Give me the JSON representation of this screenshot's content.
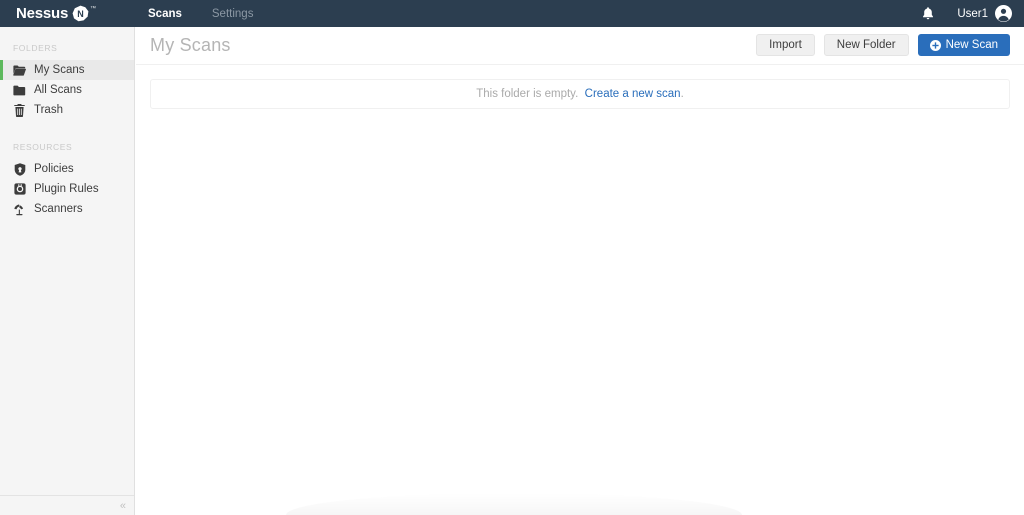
{
  "topnav": {
    "brand": {
      "word": "Nessus",
      "badge_letter": "N",
      "tm": "™",
      "icon": "nessus-logo-icon"
    },
    "links": [
      {
        "label": "Scans",
        "active": true
      },
      {
        "label": "Settings",
        "active": false
      }
    ],
    "notifications_icon": "bell-icon",
    "user_name": "User1",
    "avatar_icon": "user-avatar-icon"
  },
  "sidebar": {
    "sections": [
      {
        "title": "FOLDERS",
        "items": [
          {
            "label": "My Scans",
            "icon": "folder-open-icon",
            "active": true
          },
          {
            "label": "All Scans",
            "icon": "folder-icon",
            "active": false
          },
          {
            "label": "Trash",
            "icon": "trash-icon",
            "active": false
          }
        ]
      },
      {
        "title": "RESOURCES",
        "items": [
          {
            "label": "Policies",
            "icon": "shield-icon",
            "active": false
          },
          {
            "label": "Plugin Rules",
            "icon": "plugin-rules-icon",
            "active": false
          },
          {
            "label": "Scanners",
            "icon": "radar-dish-icon",
            "active": false
          }
        ]
      }
    ],
    "collapse_glyph": "«",
    "accent_color": "#5cb85c"
  },
  "main": {
    "page_title": "My Scans",
    "actions": [
      {
        "label": "Import",
        "style": "default"
      },
      {
        "label": "New Folder",
        "style": "default"
      },
      {
        "label": "New Scan",
        "style": "primary",
        "icon": "plus-circle-icon"
      }
    ],
    "empty_state": {
      "message": "This folder is empty.",
      "link_text": "Create a new scan",
      "trailing": "."
    }
  },
  "colors": {
    "nav_background": "#2c3e50",
    "sidebar_background": "#f5f5f5",
    "primary_blue": "#2a6ebb",
    "active_green": "#5cb85c",
    "link_blue": "#2a6ebb"
  }
}
